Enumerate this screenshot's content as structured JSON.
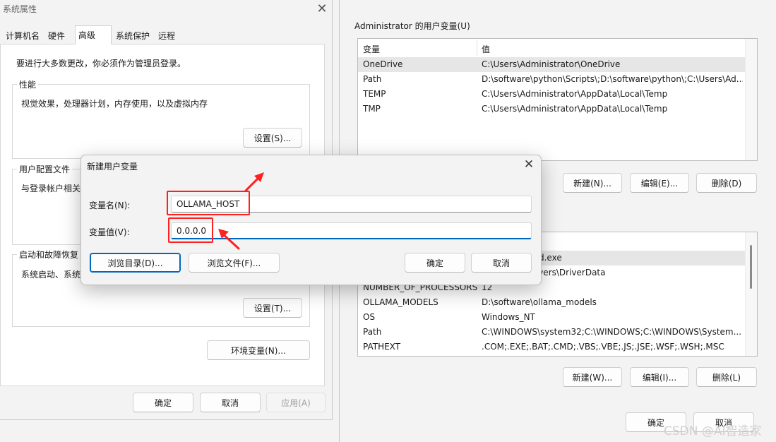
{
  "system_properties": {
    "title": "系统属性",
    "tabs": [
      "计算机名",
      "硬件",
      "高级",
      "系统保护",
      "远程"
    ],
    "active_tab": "高级",
    "admin_notice": "要进行大多数更改，你必须作为管理员登录。",
    "performance": {
      "title": "性能",
      "desc": "视觉效果，处理器计划，内存使用，以及虚拟内存",
      "button": "设置(S)..."
    },
    "user_profiles": {
      "title": "用户配置文件",
      "desc": "与登录帐户相关"
    },
    "startup_recovery": {
      "title": "启动和故障恢复",
      "desc": "系统启动、系统",
      "button": "设置(T)..."
    },
    "env_button": "环境变量(N)...",
    "ok": "确定",
    "cancel": "取消",
    "apply": "应用(A)"
  },
  "env_vars": {
    "user_section_label": "Administrator 的用户变量(U)",
    "col_name": "变量",
    "col_value": "值",
    "user_vars": [
      {
        "name": "OneDrive",
        "value": "C:\\Users\\Administrator\\OneDrive"
      },
      {
        "name": "Path",
        "value": "D:\\software\\python\\Scripts\\;D:\\software\\python\\;C:\\Users\\Ad..."
      },
      {
        "name": "TEMP",
        "value": "C:\\Users\\Administrator\\AppData\\Local\\Temp"
      },
      {
        "name": "TMP",
        "value": "C:\\Users\\Administrator\\AppData\\Local\\Temp"
      }
    ],
    "user_buttons": {
      "new": "新建(N)...",
      "edit": "编辑(E)...",
      "delete": "删除(D)"
    },
    "system_vars": [
      {
        "name": "",
        "value": "system32\\cmd.exe"
      },
      {
        "name": "",
        "value": "system32\\Drivers\\DriverData"
      },
      {
        "name": "NUMBER_OF_PROCESSORS",
        "value": "12"
      },
      {
        "name": "OLLAMA_MODELS",
        "value": "D:\\software\\ollama_models"
      },
      {
        "name": "OS",
        "value": "Windows_NT"
      },
      {
        "name": "Path",
        "value": "C:\\WINDOWS\\system32;C:\\WINDOWS;C:\\WINDOWS\\System..."
      },
      {
        "name": "PATHEXT",
        "value": ".COM;.EXE;.BAT;.CMD;.VBS;.VBE;.JS;.JSE;.WSF;.WSH;.MSC"
      }
    ],
    "system_buttons": {
      "new": "新建(W)...",
      "edit": "编辑(I)...",
      "delete": "删除(L)"
    },
    "ok": "确定",
    "cancel": "取消"
  },
  "new_var_dialog": {
    "title": "新建用户变量",
    "name_label": "变量名(N):",
    "name_value": "OLLAMA_HOST",
    "value_label": "变量值(V):",
    "value_value": "0.0.0.0",
    "browse_dir": "浏览目录(D)...",
    "browse_file": "浏览文件(F)...",
    "ok": "确定",
    "cancel": "取消"
  },
  "annotation_color": "#ff2020",
  "watermark": "CSDN @AI智造家"
}
